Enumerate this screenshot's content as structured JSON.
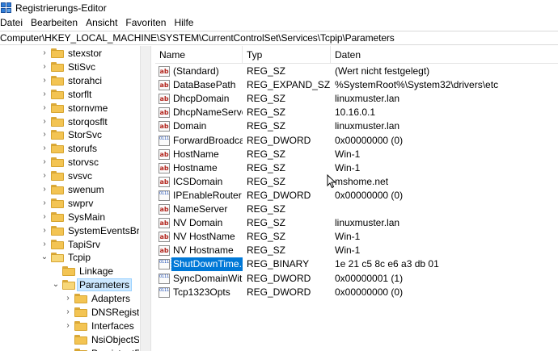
{
  "window": {
    "title": "Registrierungs-Editor"
  },
  "menu": [
    "Datei",
    "Bearbeiten",
    "Ansicht",
    "Favoriten",
    "Hilfe"
  ],
  "address": "Computer\\HKEY_LOCAL_MACHINE\\SYSTEM\\CurrentControlSet\\Services\\Tcpip\\Parameters",
  "tree": [
    {
      "label": "stexstor",
      "level": 0,
      "expander": "closed"
    },
    {
      "label": "StiSvc",
      "level": 0,
      "expander": "closed"
    },
    {
      "label": "storahci",
      "level": 0,
      "expander": "closed"
    },
    {
      "label": "storflt",
      "level": 0,
      "expander": "closed"
    },
    {
      "label": "stornvme",
      "level": 0,
      "expander": "closed"
    },
    {
      "label": "storqosflt",
      "level": 0,
      "expander": "closed"
    },
    {
      "label": "StorSvc",
      "level": 0,
      "expander": "closed"
    },
    {
      "label": "storufs",
      "level": 0,
      "expander": "closed"
    },
    {
      "label": "storvsc",
      "level": 0,
      "expander": "closed"
    },
    {
      "label": "svsvc",
      "level": 0,
      "expander": "closed"
    },
    {
      "label": "swenum",
      "level": 0,
      "expander": "closed"
    },
    {
      "label": "swprv",
      "level": 0,
      "expander": "closed"
    },
    {
      "label": "SysMain",
      "level": 0,
      "expander": "closed"
    },
    {
      "label": "SystemEventsBrok",
      "level": 0,
      "expander": "closed"
    },
    {
      "label": "TapiSrv",
      "level": 0,
      "expander": "closed"
    },
    {
      "label": "Tcpip",
      "level": 0,
      "expander": "open"
    },
    {
      "label": "Linkage",
      "level": 1,
      "expander": "none"
    },
    {
      "label": "Parameters",
      "level": 1,
      "expander": "open",
      "selected": true
    },
    {
      "label": "Adapters",
      "level": 2,
      "expander": "closed"
    },
    {
      "label": "DNSRegister",
      "level": 2,
      "expander": "closed"
    },
    {
      "label": "Interfaces",
      "level": 2,
      "expander": "closed"
    },
    {
      "label": "NsiObjectSe",
      "level": 2,
      "expander": "none"
    },
    {
      "label": "PersistentRo",
      "level": 2,
      "expander": "none"
    }
  ],
  "columns": {
    "name": "Name",
    "type": "Typ",
    "data": "Daten"
  },
  "values": [
    {
      "name": "(Standard)",
      "type": "REG_SZ",
      "data": "(Wert nicht festgelegt)",
      "icon": "sz"
    },
    {
      "name": "DataBasePath",
      "type": "REG_EXPAND_SZ",
      "data": "%SystemRoot%\\System32\\drivers\\etc",
      "icon": "sz"
    },
    {
      "name": "DhcpDomain",
      "type": "REG_SZ",
      "data": "linuxmuster.lan",
      "icon": "sz"
    },
    {
      "name": "DhcpNameServer",
      "type": "REG_SZ",
      "data": "10.16.0.1",
      "icon": "sz"
    },
    {
      "name": "Domain",
      "type": "REG_SZ",
      "data": "linuxmuster.lan",
      "icon": "sz"
    },
    {
      "name": "ForwardBroadca...",
      "type": "REG_DWORD",
      "data": "0x00000000 (0)",
      "icon": "bin"
    },
    {
      "name": "HostName",
      "type": "REG_SZ",
      "data": "Win-1",
      "icon": "sz"
    },
    {
      "name": "Hostname",
      "type": "REG_SZ",
      "data": "Win-1",
      "icon": "sz"
    },
    {
      "name": "ICSDomain",
      "type": "REG_SZ",
      "data": "mshome.net",
      "icon": "sz"
    },
    {
      "name": "IPEnableRouter",
      "type": "REG_DWORD",
      "data": "0x00000000 (0)",
      "icon": "bin"
    },
    {
      "name": "NameServer",
      "type": "REG_SZ",
      "data": "",
      "icon": "sz"
    },
    {
      "name": "NV Domain",
      "type": "REG_SZ",
      "data": "linuxmuster.lan",
      "icon": "sz"
    },
    {
      "name": "NV HostName",
      "type": "REG_SZ",
      "data": "Win-1",
      "icon": "sz"
    },
    {
      "name": "NV Hostname",
      "type": "REG_SZ",
      "data": "Win-1",
      "icon": "sz"
    },
    {
      "name": "ShutDownTime...",
      "type": "REG_BINARY",
      "data": "1e 21 c5 8c e6 a3 db 01",
      "icon": "bin",
      "selected": true
    },
    {
      "name": "SyncDomainWit...",
      "type": "REG_DWORD",
      "data": "0x00000001 (1)",
      "icon": "bin"
    },
    {
      "name": "Tcp1323Opts",
      "type": "REG_DWORD",
      "data": "0x00000000 (0)",
      "icon": "bin"
    }
  ],
  "icons": {
    "sz": "ab",
    "bin": "011110"
  }
}
